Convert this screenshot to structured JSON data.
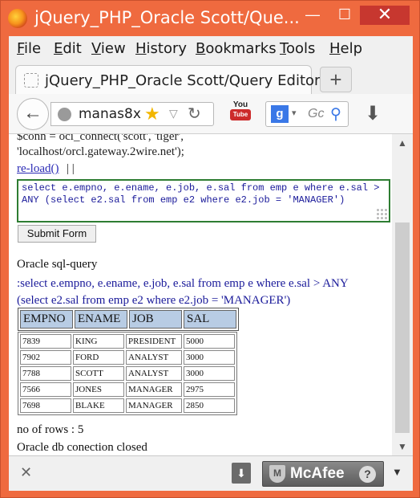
{
  "window": {
    "title": "jQuery_PHP_Oracle Scott/Que...",
    "min_label": "—",
    "max_label": "☐",
    "close_label": "✕"
  },
  "menu": [
    "File",
    "Edit",
    "View",
    "History",
    "Bookmarks",
    "Tools",
    "Help"
  ],
  "tab": {
    "title": "jQuery_PHP_Oracle Scott/Query Editor",
    "new_tab_label": "+"
  },
  "nav": {
    "url": "manas8x",
    "search_placeholder": "Gc",
    "search_engine_label": "g",
    "youtube_top": "You",
    "youtube_bottom": "Tube"
  },
  "page": {
    "code_cut": "$conn = oci_connect('scott', 'tiger',",
    "code_line2": "'localhost/orcl.gateway.2wire.net');",
    "reload_link": "re-load()",
    "pipes": "| |",
    "sql_text": "select e.empno, e.ename, e.job, e.sal from emp e where e.sal > ANY (select e2.sal from emp e2 where e2.job = 'MANAGER')",
    "submit_label": "Submit Form",
    "oracle_heading": "Oracle sql-query",
    "query_display": ":select e.empno, e.ename, e.job, e.sal from emp e where e.sal > ANY (select e2.sal from emp e2 where e2.job = 'MANAGER')",
    "columns": [
      "EMPNO",
      "ENAME",
      "JOB",
      "SAL"
    ],
    "rows": [
      [
        "7839",
        "KING",
        "PRESIDENT",
        "5000"
      ],
      [
        "7902",
        "FORD",
        "ANALYST",
        "3000"
      ],
      [
        "7788",
        "SCOTT",
        "ANALYST",
        "3000"
      ],
      [
        "7566",
        "JONES",
        "MANAGER",
        "2975"
      ],
      [
        "7698",
        "BLAKE",
        "MANAGER",
        "2850"
      ]
    ],
    "rows_count_text": "no of rows : 5",
    "closed_text": "Oracle db conection closed"
  },
  "bottom": {
    "mcafee_label": "McAfee",
    "help_label": "?",
    "close_label": "✕",
    "download_label": "⬇",
    "dropdown_label": "▼"
  },
  "icons": {
    "back": "back-arrow-icon",
    "star": "bookmark-star-icon",
    "reload": "reload-icon",
    "search": "magnifier-icon",
    "download": "download-icon"
  }
}
